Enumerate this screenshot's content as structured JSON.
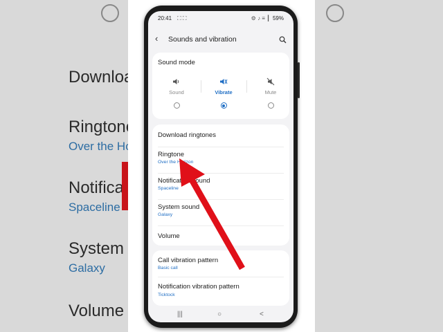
{
  "background": {
    "left_items": [
      {
        "title": "Downloa",
        "sub": ""
      },
      {
        "title": "Ringtone",
        "sub": "Over the Hor"
      },
      {
        "title": "Notificat",
        "sub": "Spaceline"
      },
      {
        "title": "System",
        "sub": "Galaxy"
      },
      {
        "title": "Volume",
        "sub": ""
      }
    ]
  },
  "status_bar": {
    "time": "20:41",
    "left_icons": "⛶ ⛶",
    "right_icons": "⚙ ♪ ≡ ┃",
    "battery": "59%"
  },
  "app_bar": {
    "title": "Sounds and vibration",
    "back_icon": "back-arrow-icon",
    "search_icon": "search-icon"
  },
  "sound_mode": {
    "title": "Sound mode",
    "options": [
      {
        "label": "Sound",
        "icon": "speaker-icon",
        "selected": false
      },
      {
        "label": "Vibrate",
        "icon": "vibrate-icon",
        "selected": true
      },
      {
        "label": "Mute",
        "icon": "mute-icon",
        "selected": false
      }
    ]
  },
  "settings": [
    {
      "title": "Download ringtones",
      "subtitle": ""
    },
    {
      "title": "Ringtone",
      "subtitle": "Over the Horizon"
    },
    {
      "title": "Notification sound",
      "subtitle": "Spaceline"
    },
    {
      "title": "System sound",
      "subtitle": "Galaxy"
    },
    {
      "title": "Volume",
      "subtitle": ""
    }
  ],
  "vibration": [
    {
      "title": "Call vibration pattern",
      "subtitle": "Basic call"
    },
    {
      "title": "Notification vibration pattern",
      "subtitle": "Ticktock"
    }
  ],
  "nav_bar": {
    "recents": "|||",
    "home": "○",
    "back": "<"
  },
  "colors": {
    "accent": "#1f6ec4",
    "arrow": "#e01019"
  }
}
